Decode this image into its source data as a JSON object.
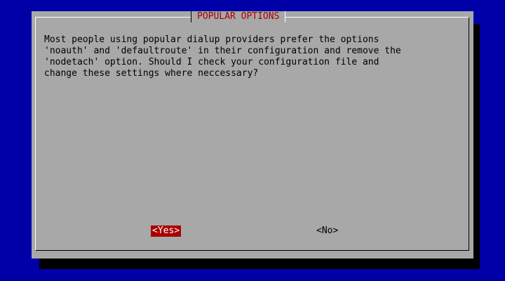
{
  "dialog": {
    "title": "POPULAR OPTIONS",
    "message": "Most people using popular dialup providers prefer the options\n'noauth' and 'defaultroute' in their configuration and remove the\n'nodetach' option. Should I check your configuration file and\nchange these settings where neccessary?"
  },
  "buttons": {
    "yes": "<Yes>",
    "no": "<No>",
    "selected": "yes"
  },
  "colors": {
    "background": "#0000a8",
    "dialog": "#a8a8a8",
    "title": "#a80000",
    "selected_button_bg": "#a80000",
    "selected_button_fg": "#ffffff"
  }
}
